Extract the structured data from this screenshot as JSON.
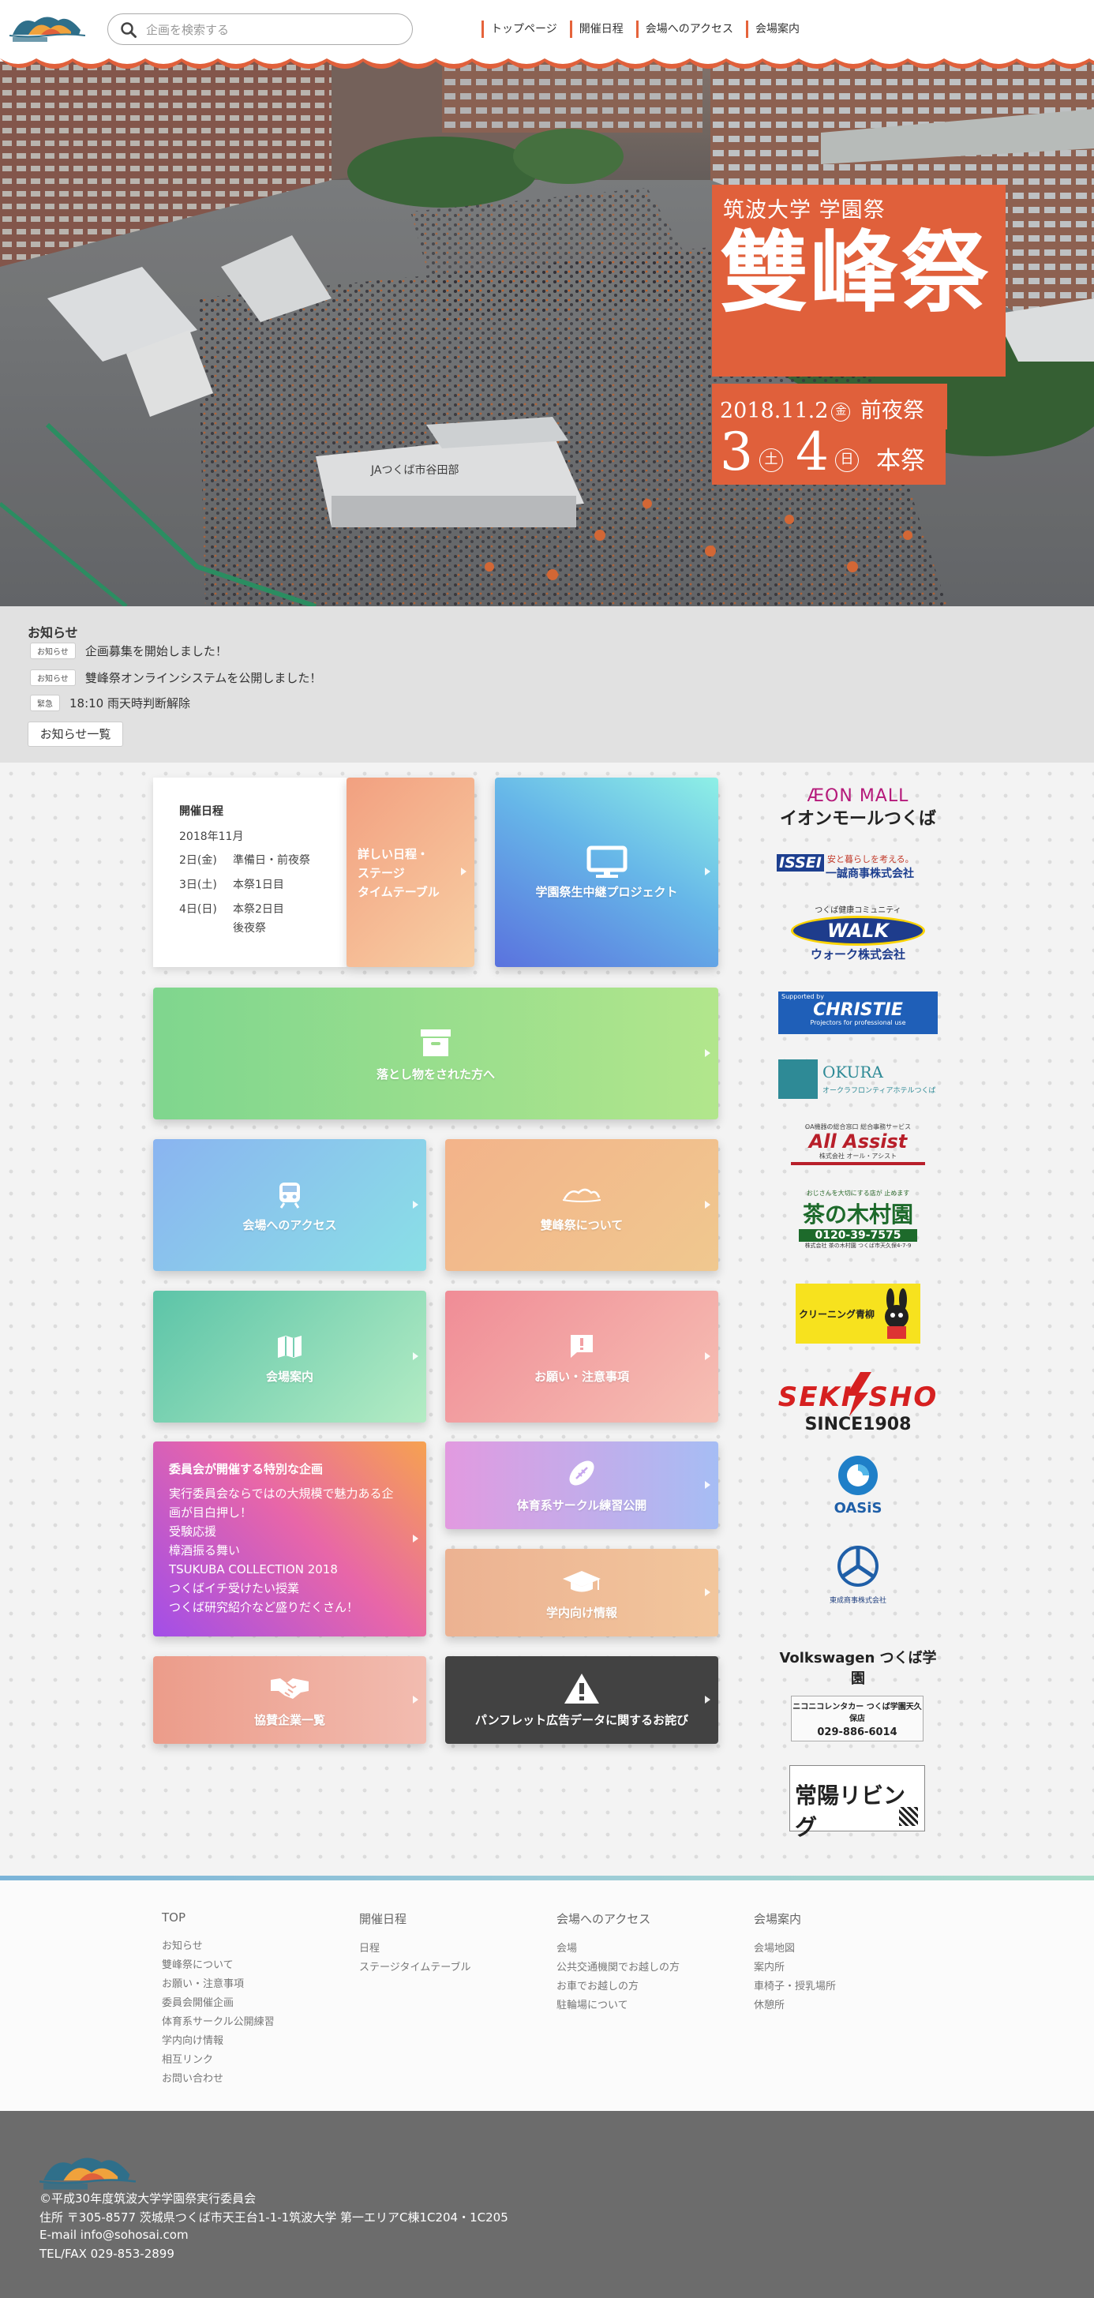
{
  "header": {
    "search_placeholder": "企画を検索する",
    "nav": [
      "トップページ",
      "開催日程",
      "会場へのアクセス",
      "会場案内"
    ]
  },
  "hero": {
    "subtitle": "筑波大学 学園祭",
    "title": "雙峰祭",
    "date_line": "2018.11.2",
    "date_day1": "金",
    "date_label1": "前夜祭",
    "main_day_a": "3",
    "main_day_a_w": "土",
    "main_day_b": "4",
    "main_day_b_w": "日",
    "main_label": "本祭",
    "sign_text": "JAつくば市谷田部"
  },
  "notices": {
    "heading": "お知らせ",
    "items": [
      {
        "tag": "お知らせ",
        "text": "企画募集を開始しました！"
      },
      {
        "tag": "お知らせ",
        "text": "雙峰祭オンラインシステムを公開しました！"
      },
      {
        "tag": "緊急",
        "text": "18:10 雨天時判断解除"
      }
    ],
    "all_button": "お知らせ一覧"
  },
  "schedule": {
    "heading": "開催日程",
    "month": "2018年11月",
    "rows": [
      {
        "day": "2日(金)",
        "label": "準備日・前夜祭"
      },
      {
        "day": "3日(土)",
        "label": "本祭1日目"
      },
      {
        "day": "4日(日)",
        "label": "本祭2日目"
      }
    ],
    "extra": "後夜祭"
  },
  "tiles": {
    "detail_schedule": [
      "詳しい日程・",
      "ステージ",
      "タイムテーブル"
    ],
    "live_project": "学園祭生中継プロジェクト",
    "lost_found": "落とし物をされた方へ",
    "access": "会場へのアクセス",
    "about": "雙峰祭について",
    "venue": "会場案内",
    "notes": "お願い・注意事項",
    "special_heading": "委員会が開催する特別な企画",
    "special_lines": [
      "実行委員会ならではの大規模で魅力ある企",
      "画が目白押し！",
      "受験応援",
      "樟酒振る舞い",
      "TSUKUBA COLLECTION 2018",
      "つくばイチ受けたい授業",
      "つくば研究紹介など盛りだくさん！"
    ],
    "sports": "体育系サークル練習公開",
    "campus": "学内向け情報",
    "sponsors": "協賛企業一覧",
    "pamphlet": "パンフレット広告データに関するお詫び"
  },
  "sponsor_logos": {
    "aeon_top": "ÆON MALL",
    "aeon_bottom": "イオンモールつくば",
    "issei_brand": "ISSEI",
    "issei_tag": "安と暮らしを考える。",
    "issei_name": "一誠商事株式会社",
    "walk_top": "つくば健康コミュニティ",
    "walk_brand": "WALK",
    "walk_name": "ウォーク株式会社",
    "christie_top": "Supported by",
    "christie_brand": "CHRISTIE",
    "christie_tag": "Projectors for professional use",
    "okura_brand": "OKURA",
    "okura_sub": "オークラフロンティアホテルつくば",
    "allassist_top": "OA機器の総合窓口 総合事務サービス",
    "allassist_brand": "All Assist",
    "allassist_name": "株式会社 オール・アシスト",
    "kimura_top": "おじさんを大切にする店が 止めます",
    "kimura_brand": "茶の木村園",
    "kimura_tel": "0120-39-7575",
    "kimura_addr": "株式会社 茶の木村園 つくば市天久保4-7-9",
    "cleaning": "クリーニング青柳",
    "sekisho_top": "SEKI",
    "sekisho_top2": "SHO",
    "sekisho_bottom": "SINCE1908",
    "oasis": "OASiS",
    "ryoki": "東成商事株式会社",
    "vw": "Volkswagen つくば学園",
    "nikoniko": "ニコニコレンタカー つくば学園天久保店",
    "nikoniko_tel": "029-886-6014",
    "newspaper": "常陽リビング"
  },
  "footer": {
    "cols": [
      {
        "heading": "TOP",
        "items": [
          "お知らせ",
          "雙峰祭について",
          "お願い・注意事項",
          "委員会開催企画",
          "体育系サークル公開練習",
          "学内向け情報",
          "相互リンク",
          "お問い合わせ"
        ]
      },
      {
        "heading": "開催日程",
        "items": [
          "日程",
          "ステージタイムテーブル"
        ]
      },
      {
        "heading": "会場へのアクセス",
        "items": [
          "会場",
          "公共交通機関でお越しの方",
          "お車でお越しの方",
          "駐輪場について"
        ]
      },
      {
        "heading": "会場案内",
        "items": [
          "会場地図",
          "案内所",
          "車椅子・授乳場所",
          "休憩所"
        ]
      }
    ],
    "copyright": "©平成30年度筑波大学学園祭実行委員会",
    "address": "住所 〒305-8577 茨城県つくば市天王台1-1-1筑波大学 第一エリアC棟1C204・1C205",
    "email": "E-mail info@sohosai.com",
    "tel": "TEL/FAX 029-853-2899"
  },
  "colors": {
    "accent": "#e0603b",
    "footer_bg": "#6c6c6c"
  }
}
